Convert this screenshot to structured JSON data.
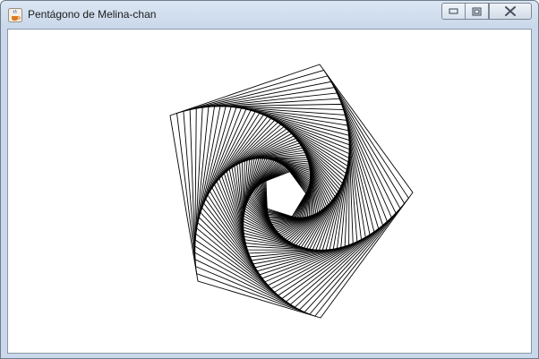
{
  "window": {
    "title": "Pentágono de Melina-chan",
    "app_icon": "java-cup-icon",
    "controls": {
      "minimize": "minimize-icon",
      "maximize": "maximize-icon",
      "close": "close-icon"
    }
  },
  "drawing": {
    "shape": "pentagon",
    "stroke_color": "#000000",
    "background_color": "#ffffff"
  }
}
